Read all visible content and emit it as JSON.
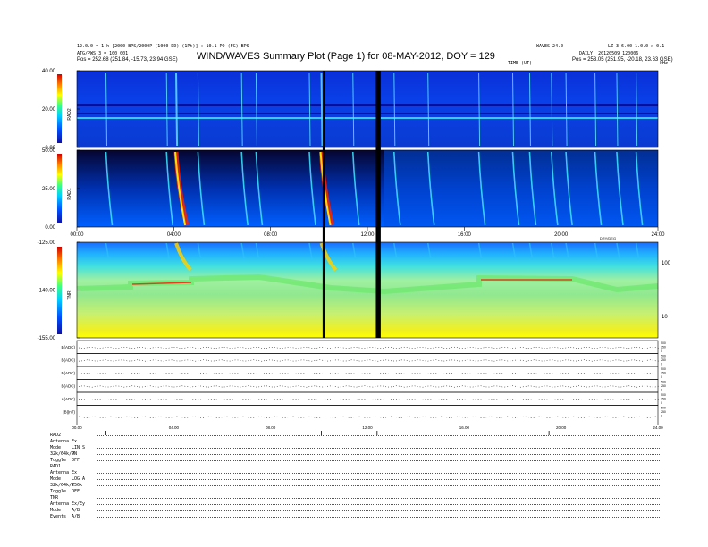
{
  "header": {
    "title": "WIND/WAVES Summary Plot (Page 1) for 08-MAY-2012, DOY = 129",
    "left_line1": "12.0.0 = 1 h [2000 BPS/2000P (1000 DD) (1Pt)] : 10.1 PO (FG) BPS",
    "left_line2": "ATG/PWS 3 = 100 001",
    "left_pos_label": "Pos =",
    "left_pos_value": "252.68 (251.84, -15.73, 23.94 GSE)",
    "right_top": "WAVES 24.0",
    "right_top2": "LZ-3 6.00 1.0.0 x 0.1",
    "right_line2": "DAILY: 20120509 120006",
    "right_pos_label": "Pos =",
    "right_pos_value": "253.05 (251.95, -20.18, 23.63 GSE)",
    "tnr_marker": "TIME (UT)",
    "right_corner": "kHz"
  },
  "panels": {
    "rad2": {
      "label": "RAD2",
      "ticks": [
        "40.00",
        "20.00",
        "0.00"
      ]
    },
    "rad1": {
      "label": "RAD1",
      "ticks": [
        "50.00",
        "25.00",
        "0.00"
      ]
    },
    "tnr": {
      "label": "TNR",
      "ticks": [
        "-125.00",
        "-140.00",
        "-155.00"
      ],
      "right_ticks": [
        "100",
        "10"
      ],
      "top_label": "DRY/DEG"
    },
    "time_ticks": [
      "00:00",
      "04:00",
      "08:00",
      "12:00",
      "16:00",
      "20:00",
      "24:00"
    ],
    "strip_labels": [
      "B(ADC)",
      "B(ADC)",
      "B(ADC)",
      "B(ADC)",
      "A(ADC)",
      "|B|(nT)"
    ],
    "strip_right": [
      "500",
      "250",
      "0"
    ]
  },
  "footer": {
    "rows": [
      [
        "RAD2",
        ""
      ],
      [
        "Antenna",
        "Ex"
      ],
      [
        "Mode",
        "LIN S"
      ],
      [
        "32k/64k/P",
        "ON"
      ],
      [
        "Toggle",
        "OFF"
      ],
      [
        "RAD1",
        ""
      ],
      [
        "Antenna",
        "Ex"
      ],
      [
        "Mode",
        "LOG A"
      ],
      [
        "32k/64k/P",
        "256k"
      ],
      [
        "Toggle",
        "OFF"
      ],
      [
        "TNR",
        ""
      ],
      [
        "Antenna",
        "Ex/Ey"
      ],
      [
        "Mode",
        "A/B"
      ],
      [
        "Events",
        "A/B"
      ]
    ]
  },
  "chart_data": {
    "type": "heatmap",
    "title": "WIND/WAVES Summary Plot (Page 1) for 08-MAY-2012, DOY = 129",
    "x_axis": {
      "label": "",
      "range": [
        0,
        24
      ],
      "unit": "hours UT",
      "ticks": [
        "00:00",
        "04:00",
        "08:00",
        "12:00",
        "16:00",
        "20:00",
        "24:00"
      ]
    },
    "panels": [
      {
        "name": "RAD2",
        "yrange": [
          0,
          40
        ],
        "ticks": [
          40,
          20,
          0
        ],
        "colorscale": "jet"
      },
      {
        "name": "RAD1",
        "yrange": [
          0,
          50
        ],
        "ticks": [
          50,
          25,
          0
        ],
        "colorscale": "jet"
      },
      {
        "name": "TNR",
        "yrange": [
          -155,
          -125
        ],
        "ticks": [
          -125,
          -140,
          -155
        ],
        "right_ticks": [
          100,
          10
        ],
        "colorscale": "jet"
      }
    ],
    "type_iii_bursts_hours": [
      1.2,
      3.7,
      4.1,
      5.0,
      6.8,
      7.4,
      9.6,
      10.1,
      11.4,
      13.1,
      14.5,
      16.6,
      18.0,
      18.7,
      19.6,
      20.2,
      21.4,
      22.3,
      23.1
    ],
    "major_bursts_hours": [
      4.1,
      10.1
    ],
    "data_gaps_hours": [
      [
        10.15,
        10.25
      ],
      [
        12.35,
        12.55
      ]
    ]
  }
}
